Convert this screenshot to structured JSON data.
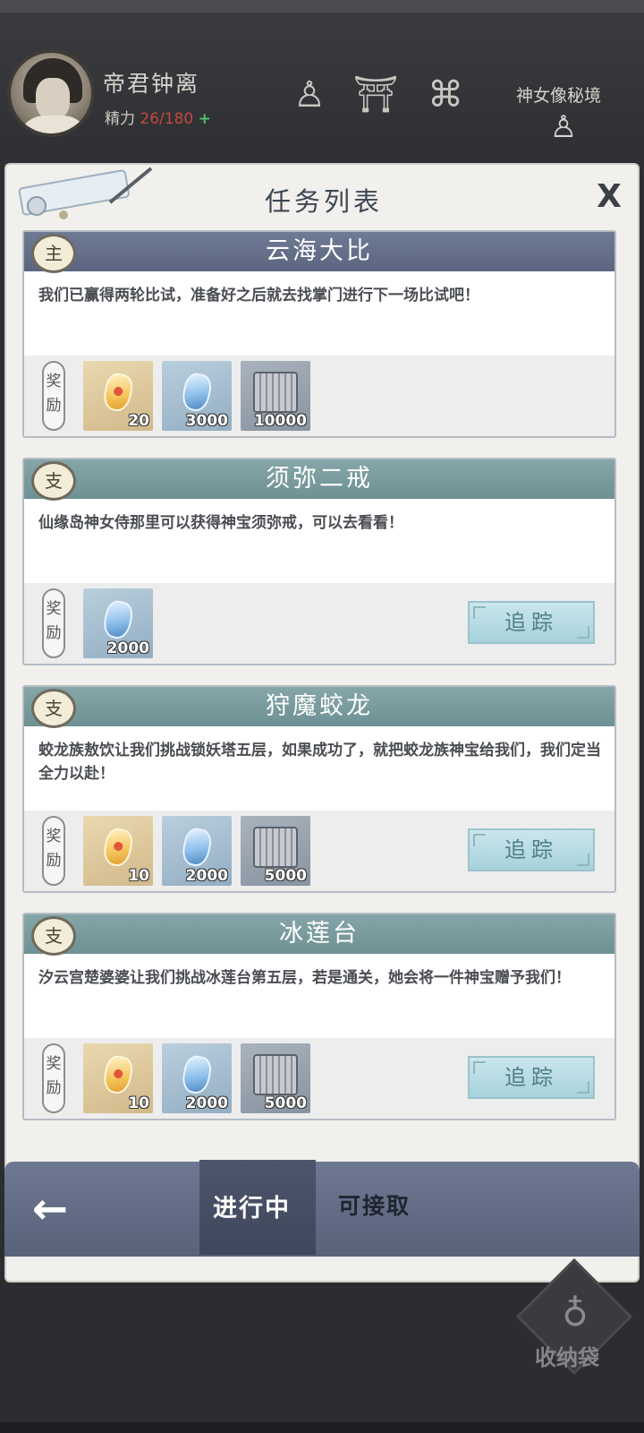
{
  "header": {
    "player_name": "帝君钟离",
    "stamina_label": "精力",
    "stamina_value": "26/180",
    "stamina_plus": "+",
    "secret_realm_label": "神女像秘境",
    "icons": [
      "statue-icon",
      "pavilion-icon",
      "scroll-map-icon",
      "statue-icon"
    ]
  },
  "panel": {
    "title": "任务列表",
    "close_glyph": "X"
  },
  "quests": [
    {
      "badge": "主",
      "type": "main",
      "title": "云海大比",
      "description": "我们已赢得两轮比试，准备好之后就去找掌门进行下一场比试吧！",
      "reward_label": "奖励",
      "rewards": [
        {
          "kind": "gold-gem",
          "qty": "20"
        },
        {
          "kind": "blue-crystal",
          "qty": "3000"
        },
        {
          "kind": "scroll",
          "qty": "10000"
        }
      ],
      "track_label": ""
    },
    {
      "badge": "支",
      "type": "side",
      "title": "须弥二戒",
      "description": "仙缘岛神女侍那里可以获得神宝须弥戒，可以去看看！",
      "reward_label": "奖励",
      "rewards": [
        {
          "kind": "blue-crystal",
          "qty": "2000"
        }
      ],
      "track_label": "追踪"
    },
    {
      "badge": "支",
      "type": "side",
      "title": "狩魔蛟龙",
      "description": "蛟龙族敖饮让我们挑战锁妖塔五层，如果成功了，就把蛟龙族神宝给我们，我们定当全力以赴！",
      "reward_label": "奖励",
      "rewards": [
        {
          "kind": "gold-gem",
          "qty": "10"
        },
        {
          "kind": "blue-crystal",
          "qty": "2000"
        },
        {
          "kind": "scroll",
          "qty": "5000"
        }
      ],
      "track_label": "追踪"
    },
    {
      "badge": "支",
      "type": "side",
      "title": "冰莲台",
      "description": "汐云宫楚婆婆让我们挑战冰莲台第五层，若是通关，她会将一件神宝赠予我们！",
      "reward_label": "奖励",
      "rewards": [
        {
          "kind": "gold-gem",
          "qty": "10"
        },
        {
          "kind": "blue-crystal",
          "qty": "2000"
        },
        {
          "kind": "scroll",
          "qty": "5000"
        }
      ],
      "track_label": "追踪"
    }
  ],
  "tabs": {
    "back_glyph": "←",
    "in_progress": "进行中",
    "available": "可接取"
  },
  "bag": {
    "label": "收纳袋"
  },
  "colors": {
    "main_header": "#5b6580",
    "side_header": "#6e9194",
    "stamina_value": "#c24a3a",
    "stamina_plus": "#4fbf6a",
    "track_button": "#a7d2dc"
  }
}
